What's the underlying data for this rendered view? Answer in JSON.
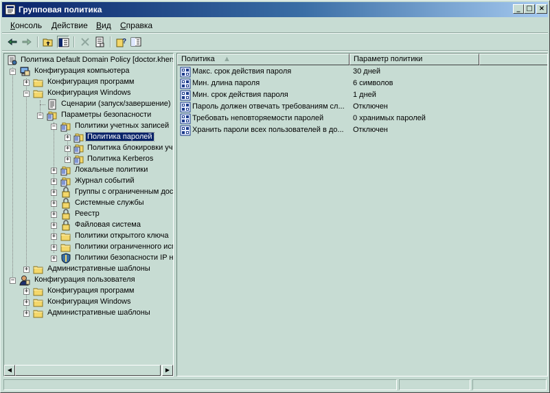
{
  "window": {
    "title": "Групповая политика",
    "buttons": {
      "minimize": "_",
      "maximize": "□",
      "close": "×"
    }
  },
  "menu": [
    {
      "label": "Консоль",
      "hotkey": "К",
      "rest": "онсоль"
    },
    {
      "label": "Действие",
      "hotkey": "Д",
      "rest": "ействие"
    },
    {
      "label": "Вид",
      "hotkey": "В",
      "rest": "ид"
    },
    {
      "label": "Справка",
      "hotkey": "С",
      "rest": "правка"
    }
  ],
  "toolbar": {
    "buttons": [
      "back-icon",
      "forward-icon",
      "up-folder-icon",
      "show-tree-icon",
      "delete-icon",
      "properties-icon",
      "help-icon",
      "export-list-icon"
    ]
  },
  "tree": {
    "root": "Политика Default Domain Policy [doctor.khers",
    "computer_config": "Конфигурация компьютера",
    "cc_programs": "Конфигурация программ",
    "cc_windows": "Конфигурация Windows",
    "scripts": "Сценарии (запуск/завершение)",
    "security_settings": "Параметры безопасности",
    "account_policies": "Политики учетных записей",
    "password_policy": "Политика паролей",
    "lockout_policy": "Политика блокировки уч",
    "kerberos_policy": "Политика Kerberos",
    "local_policies": "Локальные политики",
    "event_log": "Журнал событий",
    "restricted_groups": "Группы с ограниченным дос",
    "system_services": "Системные службы",
    "registry": "Реестр",
    "file_system": "Файловая система",
    "public_key_policies": "Политики открытого ключа",
    "software_restriction": "Политики ограниченного исп",
    "ip_security": "Политики безопасности IP н",
    "cc_admin_templates": "Административные шаблоны",
    "user_config": "Конфигурация пользователя",
    "uc_programs": "Конфигурация программ",
    "uc_windows": "Конфигурация Windows",
    "uc_admin_templates": "Административные шаблоны"
  },
  "list": {
    "columns": [
      "Политика",
      "Параметр политики"
    ],
    "rows": [
      {
        "policy": "Макс. срок действия пароля",
        "setting": "30 дней"
      },
      {
        "policy": "Мин. длина пароля",
        "setting": "6 символов"
      },
      {
        "policy": "Мин. срок действия пароля",
        "setting": "1 дней"
      },
      {
        "policy": "Пароль должен отвечать требованиям сл...",
        "setting": "Отключен"
      },
      {
        "policy": "Требовать неповторяемости паролей",
        "setting": "0 хранимых паролей"
      },
      {
        "policy": "Хранить пароли всех пользователей в до...",
        "setting": "Отключен"
      }
    ]
  },
  "colors": {
    "face": "#c7dcd3",
    "title_start": "#0a246a",
    "title_end": "#a6caf0",
    "selection": "#0a246a",
    "folder": "#f3d76a"
  }
}
